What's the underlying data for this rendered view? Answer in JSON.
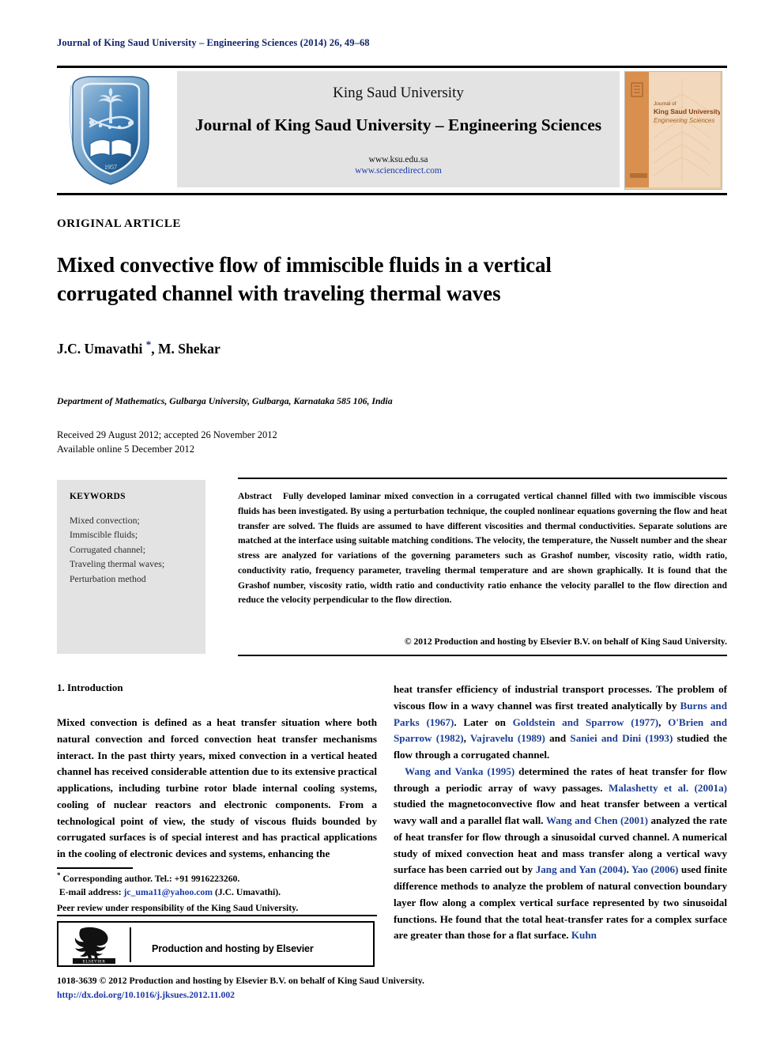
{
  "running_head": "Journal of King Saud University – Engineering Sciences (2014) 26, 49–68",
  "masthead": {
    "university": "King Saud University",
    "journal_title": "Journal of King Saud University – Engineering Sciences",
    "url_ksu": "www.ksu.edu.sa",
    "url_sciencedirect": "www.sciencedirect.com",
    "logo_alt": "king-saud-university-shield-logo",
    "cover_lines": [
      "Journal of",
      "King Saud University –",
      "Engineering Sciences"
    ]
  },
  "article": {
    "type": "ORIGINAL ARTICLE",
    "title": "Mixed convective flow of immiscible fluids in a vertical corrugated channel with traveling thermal waves",
    "authors": "J.C. Umavathi , M. Shekar",
    "authors_pre": "J.C. Umavathi ",
    "authors_post": ", M. Shekar",
    "corresponding_marker": "*",
    "affiliation": "Department of Mathematics, Gulbarga University, Gulbarga, Karnataka 585 106, India",
    "received_line": "Received 29 August 2012; accepted 26 November 2012",
    "available_line": "Available online 5 December 2012"
  },
  "keywords": {
    "heading": "KEYWORDS",
    "items": [
      "Mixed convection;",
      "Immiscible fluids;",
      "Corrugated channel;",
      "Traveling thermal waves;",
      "Perturbation method"
    ]
  },
  "abstract": {
    "label": "Abstract",
    "text": "Fully developed laminar mixed convection in a corrugated vertical channel filled with two immiscible viscous fluids has been investigated. By using a perturbation technique, the coupled nonlinear equations governing the flow and heat transfer are solved. The fluids are assumed to have different viscosities and thermal conductivities. Separate solutions are matched at the interface using suitable matching conditions. The velocity, the temperature, the Nusselt number and the shear stress are analyzed for variations of the governing parameters such as Grashof number, viscosity ratio, width ratio, conductivity ratio, frequency parameter, traveling thermal temperature and are shown graphically. It is found that the Grashof number, viscosity ratio, width ratio and conductivity ratio enhance the velocity parallel to the flow direction and reduce the velocity perpendicular to the flow direction.",
    "copyright": "© 2012 Production and hosting by Elsevier B.V. on behalf of King Saud University."
  },
  "body": {
    "section_heading": "1. Introduction",
    "left_paragraph": "Mixed convection is defined as a heat transfer situation where both natural convection and forced convection heat transfer mechanisms interact. In the past thirty years, mixed convection in a vertical heated channel has received considerable attention due to its extensive practical applications, including turbine rotor blade internal cooling systems, cooling of nuclear reactors and electronic components. From a technological point of view, the study of viscous fluids bounded by corrugated surfaces is of special interest and has practical applications in the cooling of electronic devices and systems, enhancing the",
    "right_paragraph_1_a": "heat transfer efficiency of industrial transport processes. The problem of viscous flow in a wavy channel was first treated analytically by ",
    "right_paragraph_1_ref1": "Burns and Parks (1967)",
    "right_paragraph_1_b": ". Later on ",
    "right_paragraph_1_ref2": "Goldstein and Sparrow (1977)",
    "right_paragraph_1_c": ", ",
    "right_paragraph_1_ref3": "O'Brien and Sparrow (1982)",
    "right_paragraph_1_d": ", ",
    "right_paragraph_1_ref4": "Vajravelu (1989)",
    "right_paragraph_1_e": " and ",
    "right_paragraph_1_ref5": "Saniei and Dini (1993)",
    "right_paragraph_1_f": " studied the flow through a corrugated channel.",
    "right_paragraph_2_ref1": "Wang and Vanka (1995)",
    "right_paragraph_2_a": " determined the rates of heat transfer for flow through a periodic array of wavy passages. ",
    "right_paragraph_2_ref2": "Malashetty et al. (2001a)",
    "right_paragraph_2_b": " studied the magnetoconvective flow and heat transfer between a vertical wavy wall and a parallel flat wall. ",
    "right_paragraph_2_ref3": "Wang and Chen (2001)",
    "right_paragraph_2_c": " analyzed the rate of heat transfer for flow through a sinusoidal curved channel. A numerical study of mixed convection heat and mass transfer along a vertical wavy surface has been carried out by ",
    "right_paragraph_2_ref4": "Jang and Yan (2004)",
    "right_paragraph_2_d": ". ",
    "right_paragraph_2_ref5": "Yao (2006)",
    "right_paragraph_2_e": " used finite difference methods to analyze the problem of natural convection boundary layer flow along a complex vertical surface represented by two sinusoidal functions. He found that the total heat-transfer rates for a complex surface are greater than those for a flat surface. ",
    "right_paragraph_2_ref6": "Kuhn"
  },
  "footnotes": {
    "corresponding": "Corresponding author. Tel.: +91 9916223260.",
    "email_label": "E-mail address: ",
    "email": "jc_uma11@yahoo.com",
    "email_suffix": " (J.C. Umavathi).",
    "peer_review": "Peer review under responsibility of the King Saud University."
  },
  "elsevier_box": {
    "text": "Production and hosting by Elsevier",
    "logo_label": "ELSEVIER"
  },
  "bottom": {
    "issn_line": "1018-3639 © 2012 Production and hosting by Elsevier B.V. on behalf of King Saud University.",
    "doi": "http://dx.doi.org/10.1016/j.jksues.2012.11.002"
  },
  "colors": {
    "header_blue": "#12246b",
    "link_blue": "#1c39a8",
    "ref_blue": "#1c3f94",
    "panel_gray": "#e3e3e3"
  }
}
